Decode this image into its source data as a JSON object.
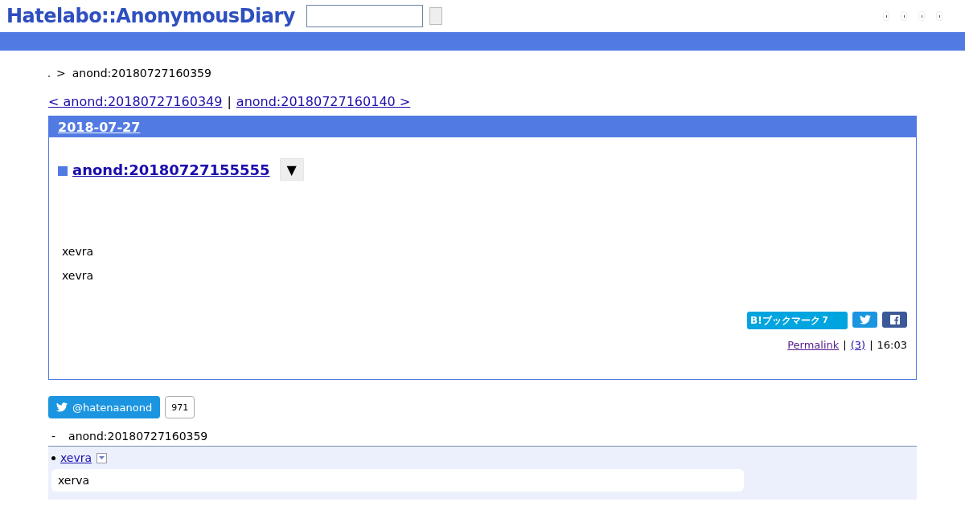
{
  "header": {
    "logo": "Hatelabo::AnonymousDiary"
  },
  "breadcrumb": {
    "separator": ">",
    "current": "anond:20180727160359"
  },
  "pager": {
    "prev": "< anond:20180727160349",
    "divider": "|",
    "next": "anond:20180727160140 >"
  },
  "day": {
    "date": "2018-07-27",
    "entry": {
      "title": "anond:20180727155555",
      "menu": "▼",
      "paragraphs": [
        "xevra",
        "xevra"
      ],
      "bookmark": {
        "label": "B!ブックマーク",
        "count": "7"
      },
      "permalink": "Permalink",
      "sep1": "|",
      "comments": "(3)",
      "sep2": "|",
      "time": "16:03"
    }
  },
  "twitter": {
    "handle": "@hatenaanond",
    "followers": "971"
  },
  "references": {
    "bullet": "-",
    "title": "anond:20180727160359",
    "items": [
      {
        "user": "xevra",
        "comment": "xerva"
      }
    ]
  }
}
